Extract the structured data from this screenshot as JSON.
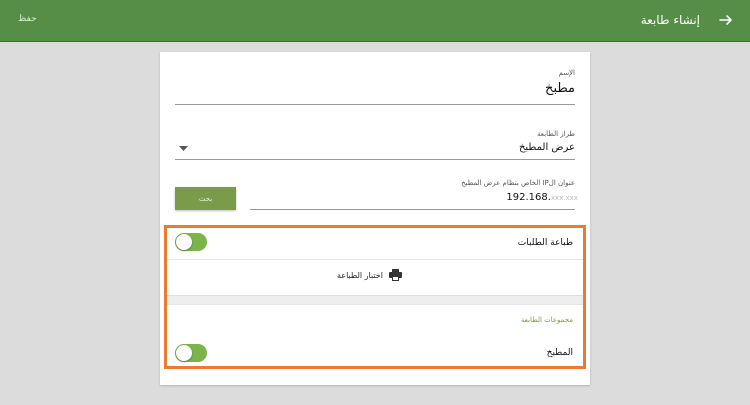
{
  "appbar": {
    "title": "إنشاء طابعة",
    "save_label": "حفظ",
    "back_icon": "arrow-right-icon"
  },
  "form": {
    "name": {
      "label": "الإسم",
      "value": "مطبخ"
    },
    "printer_model": {
      "label": "طراز الطابعة",
      "value": "عرض المطبخ"
    },
    "ip": {
      "label": "عنوان الIP الخاص بنظام عرض المطبخ",
      "value": "192.168.",
      "placeholder_rest": "xxx.xxx"
    },
    "search_label": "بحث"
  },
  "section": {
    "order_printing_label": "طباعة الطلبات",
    "order_printing_enabled": true,
    "print_test_label": "اختبار الطباعة",
    "groups_title": "مجموعات الطابعة",
    "kitchen_group_label": "المطبخ",
    "kitchen_group_enabled": true
  },
  "colors": {
    "appbar": "#568e47",
    "accent": "#7ab44a",
    "highlight_border": "#ec7b2f"
  }
}
